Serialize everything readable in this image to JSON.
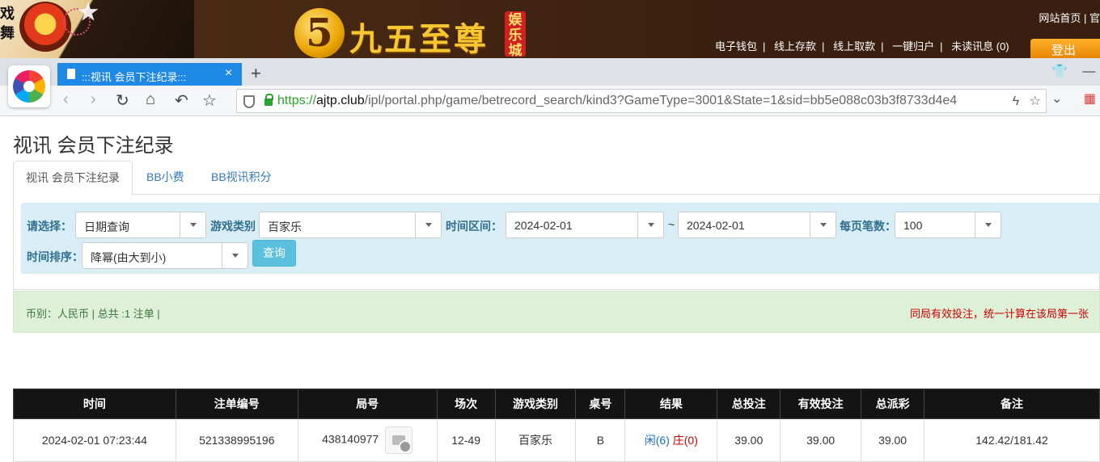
{
  "site": {
    "side_text": "戏舞",
    "logo_number": "5",
    "logo_text": "九五至尊",
    "logo_tag": "娱乐城",
    "top_right": "网站首页 | 官",
    "account_links": [
      "电子钱包",
      "线上存款",
      "线上取款",
      "一键归户",
      "未读讯息 (0)"
    ],
    "logout": "登出"
  },
  "browser": {
    "tab_title": ":::视讯 会员下注纪录:::",
    "url_scheme": "https://",
    "url_host": "ajtp.club",
    "url_path": "/ipl/portal.php/game/betrecord_search/kind3?GameType=3001&State=1&sid=bb5e088c03b3f8733d4e4"
  },
  "page": {
    "title": "视讯 会员下注纪录",
    "tabs": [
      "视讯 会员下注纪录",
      "BB小费",
      "BB视讯积分"
    ]
  },
  "filters": {
    "select_label": "请选择：",
    "select_value": "日期查询",
    "game_type_label": "游戏类别",
    "game_type_value": "百家乐",
    "time_range_label": "时间区间：",
    "date_from": "2024-02-01",
    "tilde": "~",
    "date_to": "2024-02-01",
    "per_page_label": "每页笔数：",
    "per_page_value": "100",
    "sort_label": "时间排序：",
    "sort_value": "降幂(由大到小)",
    "query_button": "查询"
  },
  "summary": {
    "left": "币别：人民币 | 总共 :1 注单 |",
    "right": "同局有效投注，统一计算在该局第一张"
  },
  "table": {
    "headers": [
      "时间",
      "注单编号",
      "局号",
      "场次",
      "游戏类别",
      "桌号",
      "结果",
      "总投注",
      "有效投注",
      "总派彩",
      "备注"
    ],
    "rows": [
      {
        "time": "2024-02-01 07:23:44",
        "order_no": "521338995196",
        "round_no": "438140977",
        "session": "12-49",
        "game_type": "百家乐",
        "table_no": "B",
        "result_player": "闲(6)",
        "result_banker": "庄(0)",
        "total_bet": "39.00",
        "valid_bet": "39.00",
        "payout": "39.00",
        "remark": "142.42/181.42"
      }
    ]
  }
}
